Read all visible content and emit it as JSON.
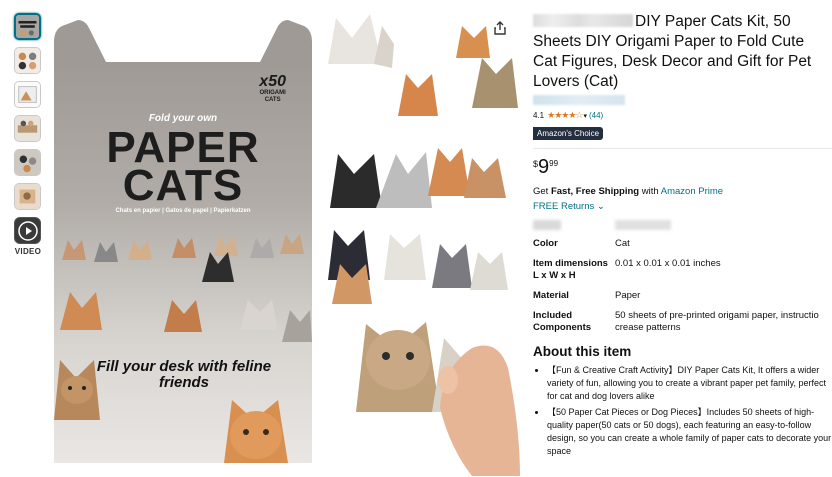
{
  "thumbnails": [
    {
      "name": "thumb-1",
      "selected": true
    },
    {
      "name": "thumb-2",
      "selected": false
    },
    {
      "name": "thumb-3",
      "selected": false
    },
    {
      "name": "thumb-4",
      "selected": false
    },
    {
      "name": "thumb-5",
      "selected": false
    },
    {
      "name": "thumb-6",
      "selected": false
    }
  ],
  "video_label": "VIDEO",
  "box": {
    "count_big": "x50",
    "count_small_1": "ORIGAMI",
    "count_small_2": "CATS",
    "fold": "Fold your own",
    "title_line1": "PAPER",
    "title_line2": "CATS",
    "languages": "Chats en papier  |  Gatos de papel  |  Papierkatzen",
    "fill_text": "Fill your desk with feline friends"
  },
  "product": {
    "title": "DIY Paper Cats Kit, 50 Sheets DIY Origami Paper to Fold Cute Cat Figures, Desk Decor and Gift for Pet Lovers (Cat)",
    "rating": "4.1",
    "stars": "★★★★☆",
    "review_count": "(44)",
    "badge_prefix": "Amazon's",
    "badge_word": "Choice",
    "price_currency": "$",
    "price_whole": "9",
    "price_fraction": "99",
    "shipping_prefix": "Get ",
    "shipping_bold": "Fast, Free Shipping",
    "shipping_with": " with ",
    "shipping_link": "Amazon Prime",
    "returns": "FREE Returns",
    "specs": [
      {
        "label": "Color",
        "value": "Cat"
      },
      {
        "label": "Item dimensions L x W x H",
        "value": "0.01 x 0.01 x 0.01 inches"
      },
      {
        "label": "Material",
        "value": "Paper"
      },
      {
        "label": "Included Components",
        "value": "50 sheets of pre-printed origami paper, instructio crease patterns"
      }
    ],
    "about_heading": "About this item",
    "bullets": [
      "【Fun & Creative Craft Activity】DIY Paper Cats Kit, It offers a wider variety of fun, allowing you to create a vibrant paper pet family, perfect for cat and dog lovers alike",
      "【50 Paper Cat Pieces or Dog Pieces】Includes 50 sheets of high-quality paper(50 cats or 50 dogs), each featuring an easy-to-follow design, so you can create a whole family of paper cats to decorate your space"
    ]
  },
  "colors": {
    "link": "#007185",
    "badge_bg": "#232f3e",
    "star": "#de7921"
  }
}
